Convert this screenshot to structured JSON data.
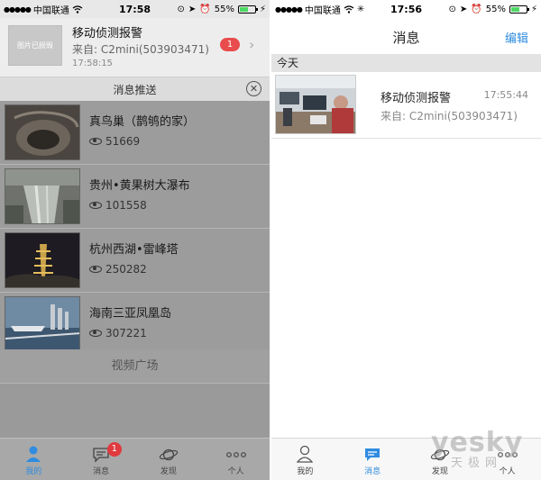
{
  "status_left": {
    "carrier": "中国联通",
    "signal_dots": "●●●●●",
    "time": "17:58",
    "battery": "55%",
    "battery_fill": 0.55
  },
  "status_right": {
    "carrier": "中国联通",
    "signal_dots": "●●●●●",
    "time": "17:56",
    "battery": "55%",
    "battery_fill": 0.55
  },
  "notification": {
    "thumb_text": "图片已损毁",
    "title": "移动侦测报警",
    "from": "来自: C2mini(503903471)",
    "time": "17:58:15",
    "badge": "1",
    "chevron": "›"
  },
  "push": {
    "title": "消息推送",
    "close": "✕",
    "items": [
      {
        "name": "真鸟巢（鹊鸲的家）",
        "views": "51669"
      },
      {
        "name": "贵州•黄果树大瀑布",
        "views": "101558"
      },
      {
        "name": "杭州西湖•雷峰塔",
        "views": "250282"
      },
      {
        "name": "海南三亚凤凰岛",
        "views": "307221"
      }
    ],
    "plaza": "视频广场"
  },
  "tabs_left": [
    {
      "label": "我的",
      "icon": "person-icon",
      "active": true
    },
    {
      "label": "消息",
      "icon": "chat-icon",
      "active": false,
      "badge": "1"
    },
    {
      "label": "发现",
      "icon": "planet-icon",
      "active": false
    },
    {
      "label": "个人",
      "icon": "more-icon",
      "active": false
    }
  ],
  "messages": {
    "title": "消息",
    "edit": "编辑",
    "section": "今天",
    "item": {
      "title": "移动侦测报警",
      "time": "17:55:44",
      "from": "来自: C2mini(503903471)"
    }
  },
  "tabs_right": [
    {
      "label": "我的",
      "icon": "person-icon",
      "active": false
    },
    {
      "label": "消息",
      "icon": "chat-icon",
      "active": true
    },
    {
      "label": "发现",
      "icon": "planet-icon",
      "active": false
    },
    {
      "label": "个人",
      "icon": "more-icon",
      "active": false
    }
  ],
  "watermark": {
    "brand": "yesky",
    "sub": "天极网"
  },
  "colors": {
    "accent": "#2f8ce0",
    "badge": "#e0393e",
    "battery": "#4cd964"
  }
}
